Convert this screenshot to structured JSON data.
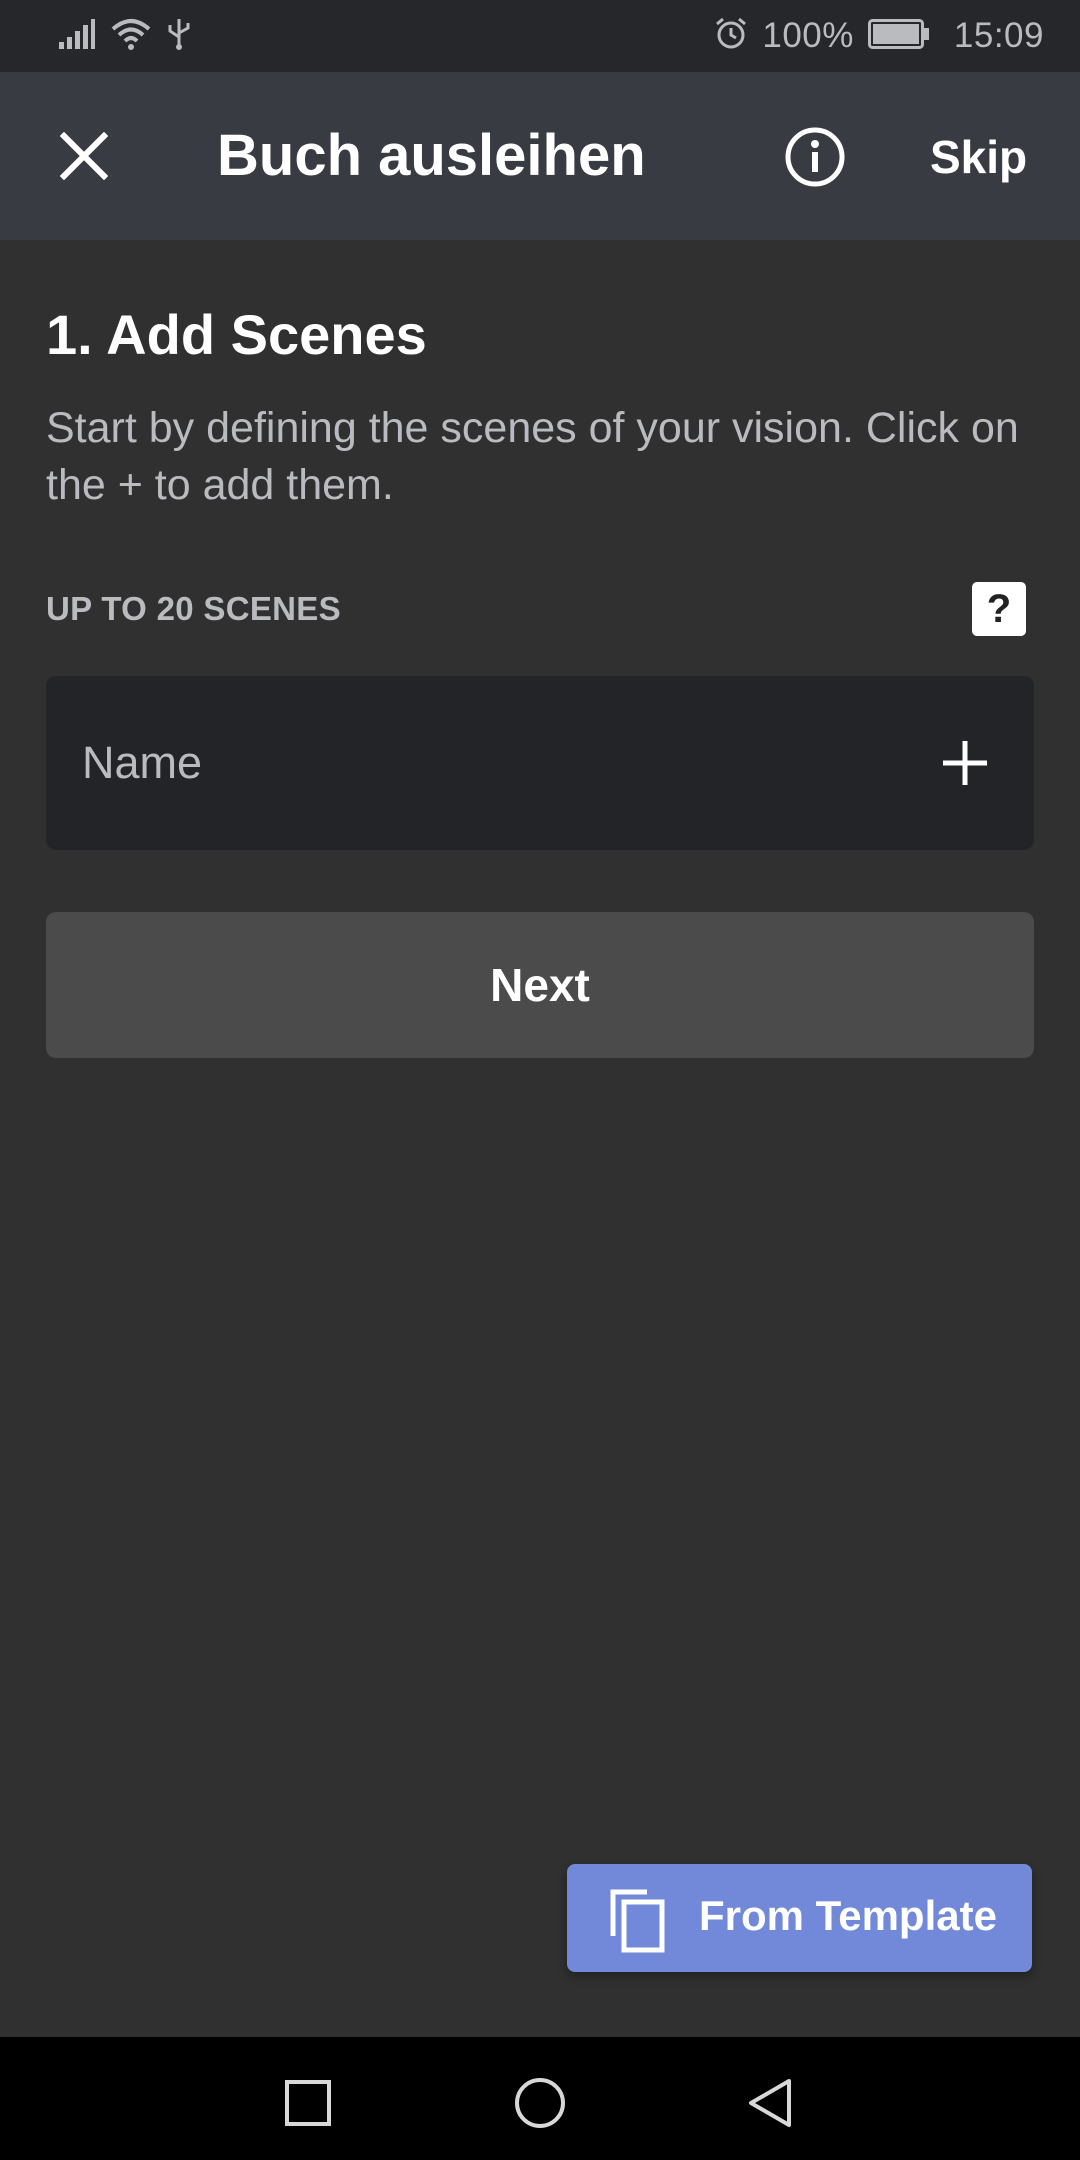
{
  "status_bar": {
    "battery_percent": "100%",
    "time": "15:09",
    "icons": [
      "signal-icon",
      "wifi-icon",
      "usb-icon",
      "alarm-icon",
      "battery-icon"
    ]
  },
  "app_bar": {
    "title": "Buch ausleihen",
    "skip_label": "Skip",
    "icons": [
      "close-icon",
      "info-icon"
    ]
  },
  "main": {
    "section_title": "1. Add Scenes",
    "description": "Start by defining the scenes of your vision. Click on the + to add them.",
    "scenes_limit_label": "UP TO 20 SCENES",
    "help_label": "?",
    "name_field": {
      "placeholder": "Name",
      "value": ""
    },
    "next_label": "Next"
  },
  "template_button": {
    "label": "From Template",
    "icon": "copy-icon"
  },
  "nav_bar": {
    "icons": [
      "recents-icon",
      "home-icon",
      "back-icon"
    ]
  },
  "colors": {
    "background": "#303030",
    "app_bar": "#383b42",
    "status_bar": "#26272b",
    "input_bg": "#232428",
    "next_button": "#4b4b4b",
    "accent": "#7289da",
    "secondary_text": "#b9bbbf"
  }
}
